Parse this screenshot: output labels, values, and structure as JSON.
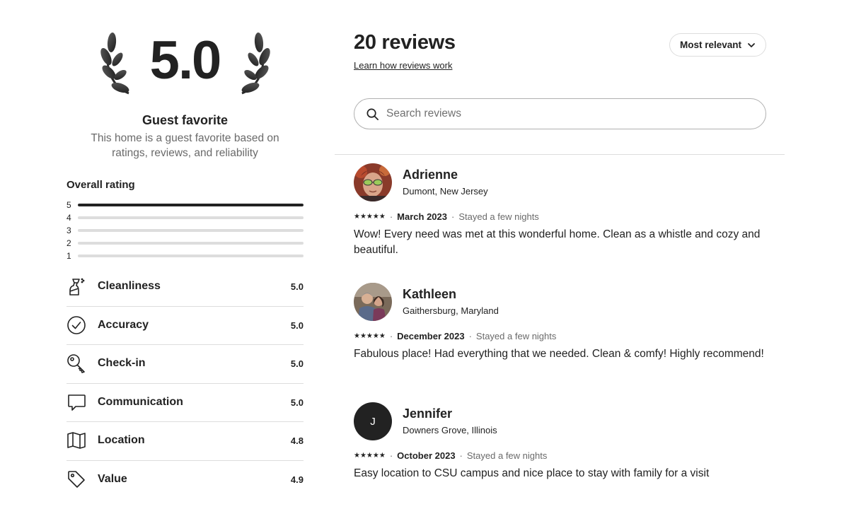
{
  "summary": {
    "score": "5.0",
    "title": "Guest favorite",
    "description": "This home is a guest favorite based on ratings, reviews, and reliability"
  },
  "overall": {
    "title": "Overall rating",
    "distribution": [
      {
        "stars": "5",
        "fraction": 1.0
      },
      {
        "stars": "4",
        "fraction": 0.0
      },
      {
        "stars": "3",
        "fraction": 0.0
      },
      {
        "stars": "2",
        "fraction": 0.0
      },
      {
        "stars": "1",
        "fraction": 0.0
      }
    ]
  },
  "categories": [
    {
      "label": "Cleanliness",
      "value": "5.0",
      "icon": "spray-bottle-icon"
    },
    {
      "label": "Accuracy",
      "value": "5.0",
      "icon": "check-circle-icon"
    },
    {
      "label": "Check-in",
      "value": "5.0",
      "icon": "key-icon"
    },
    {
      "label": "Communication",
      "value": "5.0",
      "icon": "chat-bubble-icon"
    },
    {
      "label": "Location",
      "value": "4.8",
      "icon": "map-icon"
    },
    {
      "label": "Value",
      "value": "4.9",
      "icon": "price-tag-icon"
    }
  ],
  "header": {
    "count_label": "20 reviews",
    "learn_link": "Learn how reviews work",
    "sort_label": "Most relevant"
  },
  "search": {
    "placeholder": "Search reviews",
    "value": ""
  },
  "reviews": [
    {
      "name": "Adrienne",
      "location": "Dumont, New Jersey",
      "stars": "★★★★★",
      "date": "March 2023",
      "stay": "Stayed a few nights",
      "text": "Wow! Every need was met at this wonderful home. Clean as a whistle and cozy and beautiful.",
      "avatar": "photo"
    },
    {
      "name": "Kathleen",
      "location": "Gaithersburg, Maryland",
      "stars": "★★★★★",
      "date": "December 2023",
      "stay": "Stayed a few nights",
      "text": "Fabulous place! Had everything that we needed. Clean & comfy! Highly recommend!",
      "avatar": "photo"
    },
    {
      "name": "Jennifer",
      "location": "Downers Grove, Illinois",
      "stars": "★★★★★",
      "date": "October 2023",
      "stay": "Stayed a few nights",
      "text": "Easy location to CSU campus and nice place to stay with family for a visit",
      "avatar": "J"
    }
  ],
  "colors": {
    "text": "#222222",
    "muted": "#6a6a6a",
    "divider": "#dddddd",
    "bar_fill": "#222222",
    "bar_track": "#dddddd"
  }
}
